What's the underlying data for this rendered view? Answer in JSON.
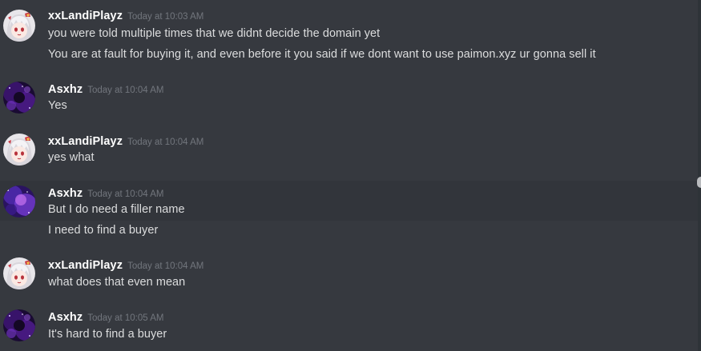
{
  "messages": [
    {
      "author": "xxLandiPlayz",
      "timestamp": "Today at 10:03 AM",
      "lines": [
        "you were told multiple times that we didnt decide the domain yet",
        "You are at fault for buying it, and even before it you said if we dont want to use paimon.xyz ur gonna sell it"
      ]
    },
    {
      "author": "Asxhz",
      "timestamp": "Today at 10:04 AM",
      "lines": [
        "Yes"
      ]
    },
    {
      "author": "xxLandiPlayz",
      "timestamp": "Today at 10:04 AM",
      "lines": [
        "yes what"
      ]
    },
    {
      "author": "Asxhz",
      "timestamp": "Today at 10:04 AM",
      "lines": [
        "But I do need a filler name",
        "I need to find a buyer"
      ]
    },
    {
      "author": "xxLandiPlayz",
      "timestamp": "Today at 10:04 AM",
      "lines": [
        "what does that even mean"
      ]
    },
    {
      "author": "Asxhz",
      "timestamp": "Today at 10:05 AM",
      "lines": [
        "It's hard to find a buyer"
      ]
    }
  ],
  "theme": {
    "background": "#36393f",
    "username_color": "#ffffff",
    "message_color": "#dcddde",
    "timestamp_color": "#72767d"
  },
  "icons": {
    "landi_avatar": "anime-girl-avatar-icon",
    "asxhz_avatar": "purple-galaxy-avatar-icon"
  }
}
